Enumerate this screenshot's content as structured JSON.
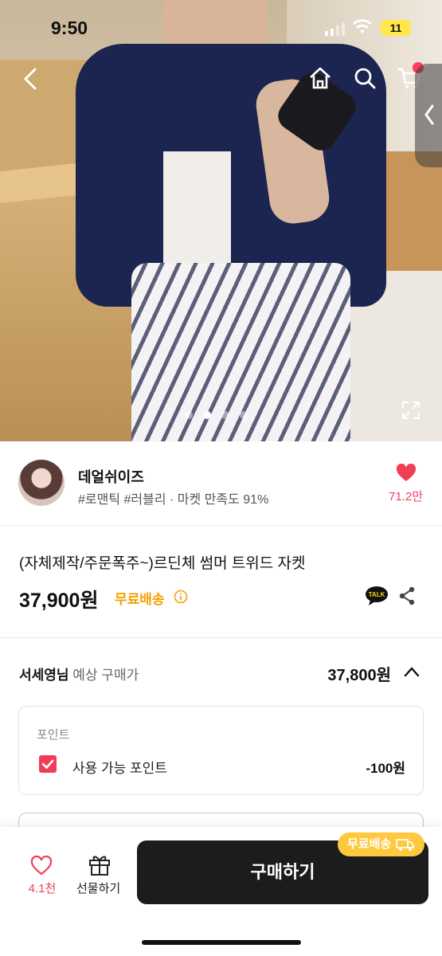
{
  "status_bar": {
    "time": "9:50",
    "battery": "11"
  },
  "gallery": {
    "image_count": 4,
    "active_index": 1
  },
  "seller": {
    "name": "데얼쉬이즈",
    "tags": "#로맨틱 #러블리 · 마켓 만족도 91%",
    "likes": "71.2만"
  },
  "product": {
    "title": "(자체제작/주문폭주~)르딘체 썸머 트위드 자켓",
    "price": "37,900원",
    "free_shipping": "무료배송"
  },
  "estimate": {
    "user": "서세영님",
    "label": "예상 구매가",
    "price": "37,800원"
  },
  "points": {
    "heading": "포인트",
    "checkbox_label": "사용 가능 포인트",
    "checked": true,
    "value": "-100원"
  },
  "bottom_bar": {
    "wish_count": "4.1천",
    "gift_label": "선물하기",
    "buy_label": "구매하기",
    "badge_label": "무료배송"
  },
  "colors": {
    "accent_pink": "#ef3e56",
    "shipping_orange": "#f5a100",
    "badge_yellow": "#ffc83d",
    "buy_button": "#1c1c1c"
  },
  "icons": [
    "back-icon",
    "home-icon",
    "search-icon",
    "cart-icon",
    "expand-icon",
    "heart-icon",
    "info-icon",
    "talk-icon",
    "share-icon",
    "chevron-up-icon",
    "check-icon",
    "wish-heart-icon",
    "gift-icon",
    "truck-icon"
  ]
}
